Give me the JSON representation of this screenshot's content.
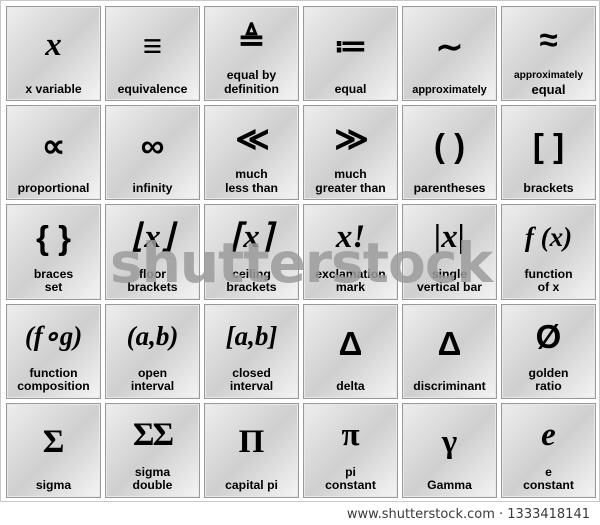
{
  "watermark": {
    "text": "shutterstock",
    "color": "#9c9c9c"
  },
  "footer": {
    "text": "www.shutterstock.com · 1333418141"
  },
  "grid": {
    "columns": 6,
    "rows": 5,
    "cells": [
      {
        "symbol": "x",
        "label": "x variable"
      },
      {
        "symbol": "≡",
        "label": "equivalence"
      },
      {
        "symbol": "≜",
        "label": "equal by\ndefinition"
      },
      {
        "symbol": "≔",
        "label": "equal"
      },
      {
        "symbol": "∼",
        "label": "approximately"
      },
      {
        "symbol": "≈",
        "label_small": "approximately",
        "label_big": "equal"
      },
      {
        "symbol": "∝",
        "label": "proportional"
      },
      {
        "symbol": "∞",
        "label": "infinity"
      },
      {
        "symbol": "≪",
        "label": "much\nless than"
      },
      {
        "symbol": "≫",
        "label": "much\ngreater than"
      },
      {
        "symbol": "( )",
        "label": "parentheses"
      },
      {
        "symbol": "[ ]",
        "label": "brackets"
      },
      {
        "symbol": "{ }",
        "label": "braces\nset"
      },
      {
        "symbol": "⌊x⌋",
        "label": "floor\nbrackets"
      },
      {
        "symbol": "⌈x⌉",
        "label": "ceiling\nbrackets"
      },
      {
        "symbol": "x!",
        "label": "exclamation\nmark"
      },
      {
        "symbol": "|x|",
        "label": "single\nvertical bar"
      },
      {
        "symbol": "f (x)",
        "label": "function\nof x"
      },
      {
        "symbol": "(f∘g)",
        "label": "function\ncomposition"
      },
      {
        "symbol": "(a,b)",
        "label": "open\ninterval"
      },
      {
        "symbol": "[a,b]",
        "label": "closed\ninterval"
      },
      {
        "symbol": "Δ",
        "label": "delta"
      },
      {
        "symbol": "Δ",
        "label": "discriminant"
      },
      {
        "symbol": "Ø",
        "label": "golden\nratio"
      },
      {
        "symbol": "Σ",
        "label": "sigma"
      },
      {
        "symbol": "ΣΣ",
        "label": "sigma\ndouble"
      },
      {
        "symbol": "Π",
        "label": "capital pi"
      },
      {
        "symbol": "π",
        "label": "pi\nconstant"
      },
      {
        "symbol": "γ",
        "label": "Gamma"
      },
      {
        "symbol": "e",
        "label": "e\nconstant"
      }
    ]
  }
}
